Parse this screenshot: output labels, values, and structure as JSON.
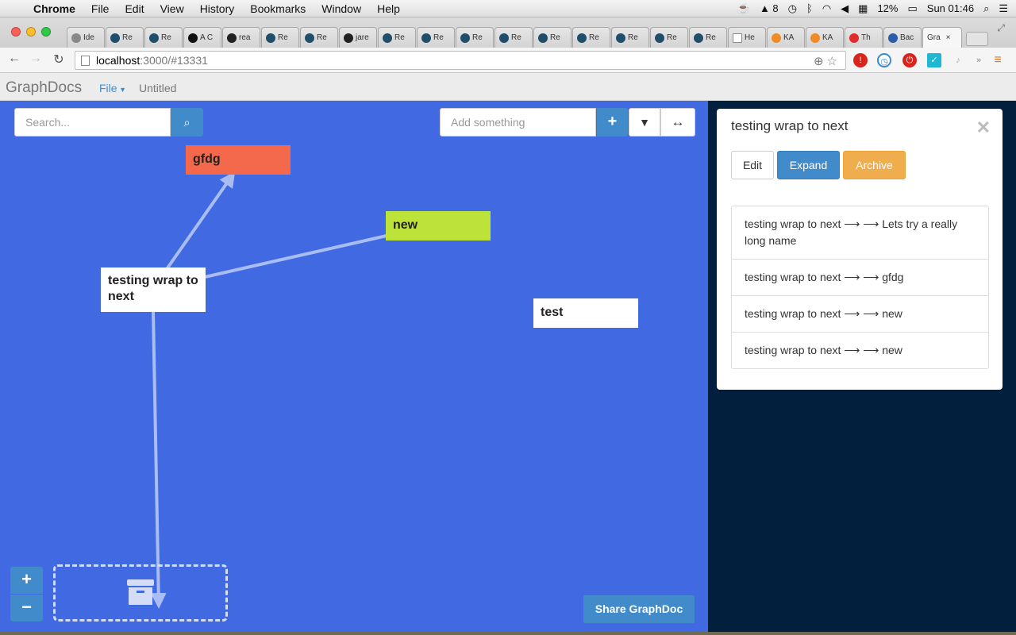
{
  "os_menu": {
    "app": "Chrome",
    "items": [
      "File",
      "Edit",
      "View",
      "History",
      "Bookmarks",
      "Window",
      "Help"
    ],
    "status": {
      "adobe_badge": "8",
      "battery": "12%",
      "clock": "Sun 01:46"
    }
  },
  "browser": {
    "tabs": [
      {
        "label": "Ide",
        "icon": "google-icon"
      },
      {
        "label": "Re",
        "icon": "react-icon"
      },
      {
        "label": "Re",
        "icon": "react-icon"
      },
      {
        "label": "A C",
        "icon": "circle-icon"
      },
      {
        "label": "rea",
        "icon": "github-icon"
      },
      {
        "label": "Re",
        "icon": "react-icon"
      },
      {
        "label": "Re",
        "icon": "react-icon"
      },
      {
        "label": "jare",
        "icon": "github-icon"
      },
      {
        "label": "Re",
        "icon": "react-icon"
      },
      {
        "label": "Re",
        "icon": "react-icon"
      },
      {
        "label": "Re",
        "icon": "react-icon"
      },
      {
        "label": "Re",
        "icon": "react-icon"
      },
      {
        "label": "Re",
        "icon": "react-icon"
      },
      {
        "label": "Re",
        "icon": "react-icon"
      },
      {
        "label": "Re",
        "icon": "react-icon"
      },
      {
        "label": "Re",
        "icon": "react-icon"
      },
      {
        "label": "Re",
        "icon": "react-icon"
      },
      {
        "label": "He",
        "icon": "page-icon"
      },
      {
        "label": "KA",
        "icon": "khan-icon"
      },
      {
        "label": "KA",
        "icon": "khan-icon"
      },
      {
        "label": "Th",
        "icon": "bf-icon"
      },
      {
        "label": "Bac",
        "icon": "bac-icon"
      }
    ],
    "active_tab": "Gra",
    "url_host": "localhost",
    "url_path": ":3000/#13331"
  },
  "app": {
    "brand": "GraphDocs",
    "file_menu": "File",
    "doc_title": "Untitled"
  },
  "toolbar": {
    "search_placeholder": "Search...",
    "add_placeholder": "Add something"
  },
  "graph": {
    "nodes": [
      {
        "id": "gfdg",
        "label": "gfdg",
        "color": "#f4694b"
      },
      {
        "id": "new",
        "label": "new",
        "color": "#bde23a"
      },
      {
        "id": "testing",
        "label": "testing wrap to next",
        "color": "#ffffff"
      },
      {
        "id": "test",
        "label": "test",
        "color": "#ffffff"
      }
    ]
  },
  "share_button": "Share GraphDoc",
  "detail_panel": {
    "title": "testing wrap to next",
    "buttons": {
      "edit": "Edit",
      "expand": "Expand",
      "archive": "Archive"
    },
    "connections": [
      "testing wrap to next ⟶ ⟶ Lets try a really long name",
      "testing wrap to next ⟶ ⟶ gfdg",
      "testing wrap to next ⟶ ⟶ new",
      "testing wrap to next ⟶ ⟶ new"
    ]
  },
  "colors": {
    "canvas": "#4169e1",
    "panel_bg": "#031f3e",
    "primary": "#428bca",
    "warning": "#f0ad4e"
  }
}
